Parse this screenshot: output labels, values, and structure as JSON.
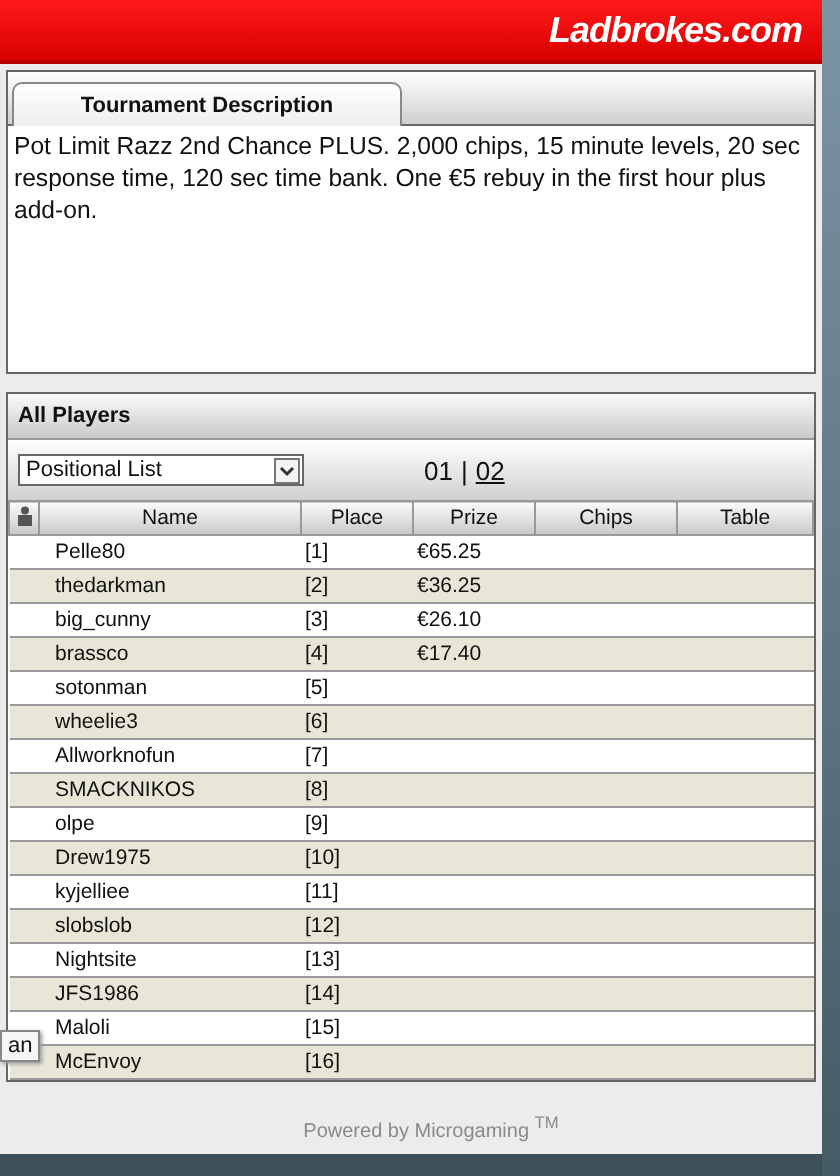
{
  "header": {
    "logo": "Ladbrokes.com"
  },
  "description_panel": {
    "tab": "Tournament Description",
    "text": "Pot Limit Razz 2nd Chance PLUS. 2,000 chips, 15 minute levels, 20 sec response time, 120 sec time bank. One €5 rebuy in the first hour plus add-on."
  },
  "players_panel": {
    "title": "All Players",
    "list_select": {
      "value": "Positional List"
    },
    "pages": [
      {
        "label": "01",
        "selected": true
      },
      {
        "label": "02",
        "selected": false
      }
    ],
    "separator": "|",
    "columns": [
      "Name",
      "Place",
      "Prize",
      "Chips",
      "Table"
    ],
    "rows": [
      {
        "name": "Pelle80",
        "place": "[1]",
        "prize": "€65.25"
      },
      {
        "name": "thedarkman",
        "place": "[2]",
        "prize": "€36.25"
      },
      {
        "name": "big_cunny",
        "place": "[3]",
        "prize": "€26.10"
      },
      {
        "name": "brassco",
        "place": "[4]",
        "prize": "€17.40"
      },
      {
        "name": "sotonman",
        "place": "[5]"
      },
      {
        "name": "wheelie3",
        "place": "[6]"
      },
      {
        "name": "Allworknofun",
        "place": "[7]"
      },
      {
        "name": "SMACKNIKOS",
        "place": "[8]"
      },
      {
        "name": "olpe",
        "place": "[9]"
      },
      {
        "name": "Drew1975",
        "place": "[10]"
      },
      {
        "name": "kyjelliee",
        "place": "[11]"
      },
      {
        "name": "slobslob",
        "place": "[12]"
      },
      {
        "name": "Nightsite",
        "place": "[13]"
      },
      {
        "name": "JFS1986",
        "place": "[14]"
      },
      {
        "name": "Maloli",
        "place": "[15]"
      },
      {
        "name": "McEnvoy",
        "place": "[16]"
      }
    ]
  },
  "tooltip": "an",
  "footer": "Powered by Microgaming $^{TM}$"
}
